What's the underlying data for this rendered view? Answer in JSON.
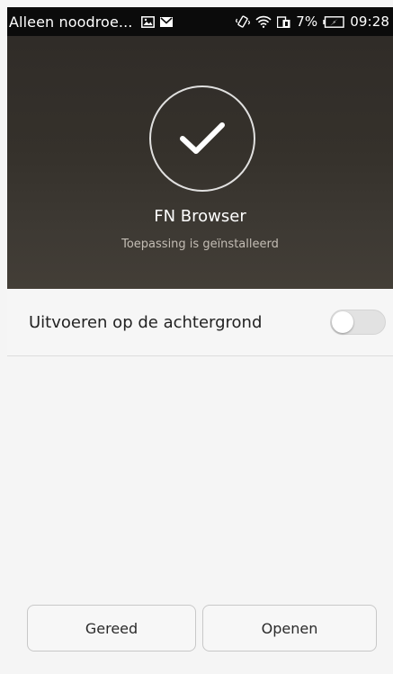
{
  "status_bar": {
    "carrier": "Alleen noodroe...",
    "battery": "7%",
    "time": "09:28",
    "icons": [
      "gallery-icon",
      "mail-icon",
      "vibrate-icon",
      "wifi-icon",
      "phone-icon",
      "battery-charging-icon"
    ]
  },
  "header": {
    "icon": "checkmark-icon",
    "app_name": "FN Browser",
    "status": "Toepassing is geïnstalleerd"
  },
  "background_option": {
    "label": "Uitvoeren op de achtergrond",
    "enabled": false
  },
  "buttons": {
    "done": "Gereed",
    "open": "Openen"
  }
}
